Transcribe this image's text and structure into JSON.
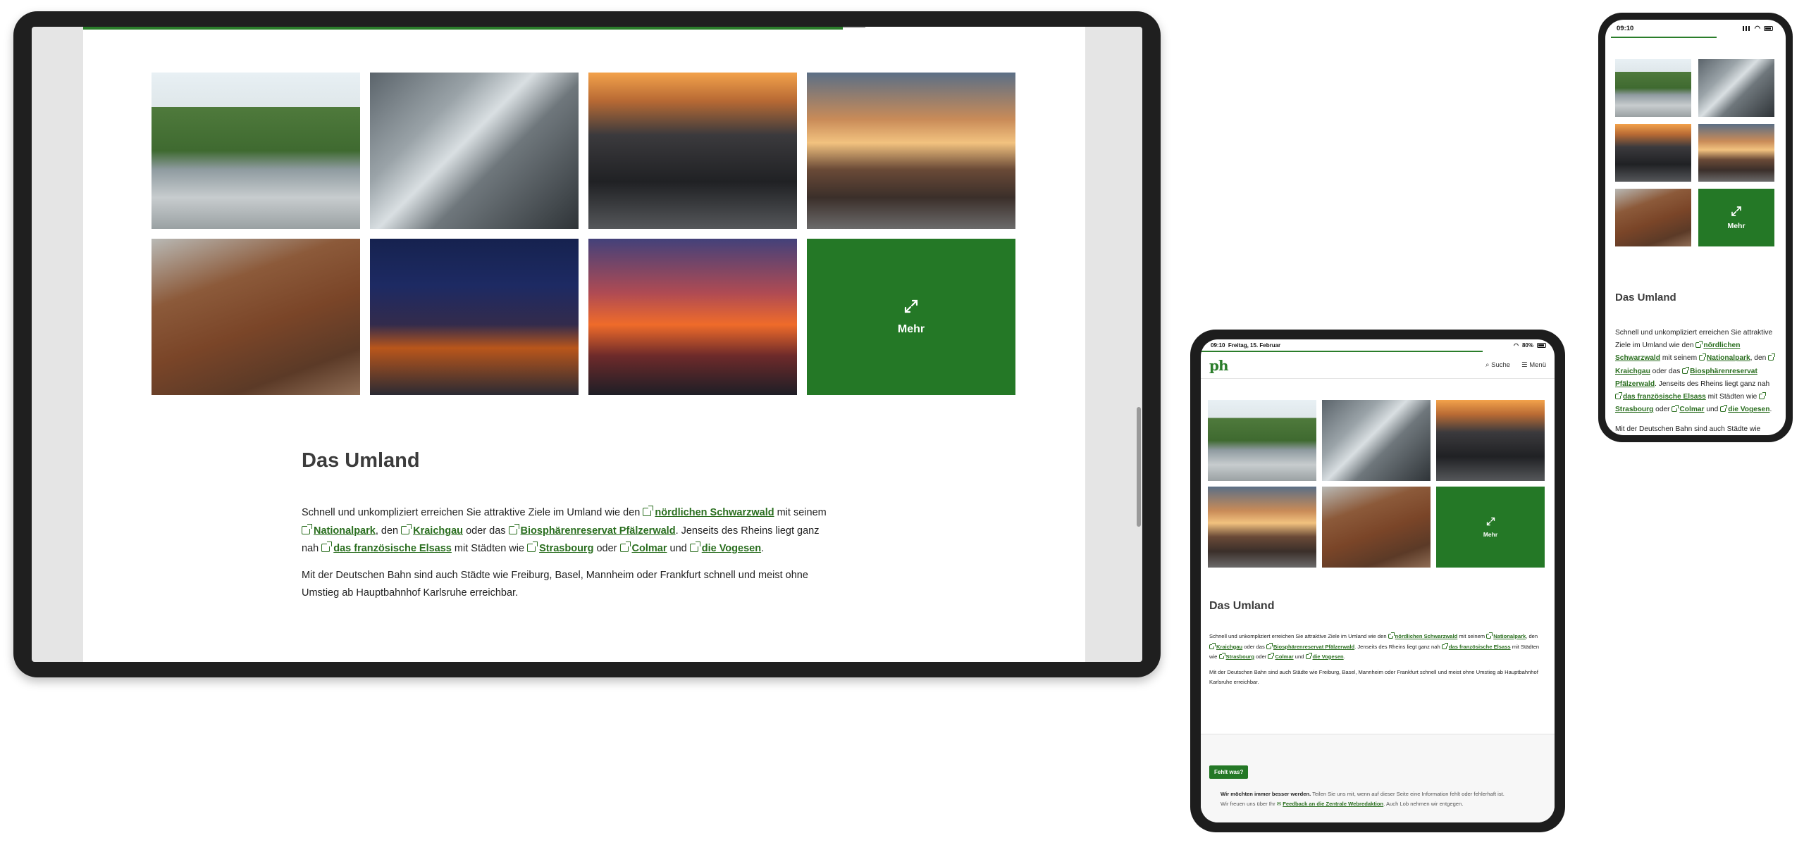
{
  "colors": {
    "brand_green": "#247826",
    "link_green": "#2a6e1f"
  },
  "gallery": {
    "more_label": "Mehr",
    "images": [
      {
        "alt": "fountain-street"
      },
      {
        "alt": "cyclist-pole"
      },
      {
        "alt": "tram-tracks-sunset"
      },
      {
        "alt": "castle-sunset"
      },
      {
        "alt": "rusty-metal"
      },
      {
        "alt": "city-night"
      },
      {
        "alt": "ferris-wheel-sunset"
      }
    ]
  },
  "section": {
    "title": "Das Umland",
    "p1": {
      "t1": "Schnell und unkompliziert erreichen Sie attraktive Ziele im Umland wie den ",
      "l1": "nördlichen Schwarzwald",
      "t2": " mit seinem ",
      "l2": "Nationalpark",
      "t3": ", den ",
      "l3": "Kraichgau",
      "t4": " oder das ",
      "l4": "Biosphärenreservat Pfälzerwald",
      "t5": ". Jenseits des Rheins liegt ganz nah ",
      "l5": "das französische Elsass",
      "t6": " mit Städten wie ",
      "l6": "Strasbourg",
      "t7": " oder ",
      "l7": "Colmar",
      "t8": " und ",
      "l8": "die Vogesen",
      "t9": "."
    },
    "p2": "Mit der Deutschen Bahn sind auch Städte wie Freiburg, Basel, Mannheim oder Frankfurt schnell und meist ohne Umstieg ab Hauptbahnhof Karlsruhe erreichbar."
  },
  "ipad": {
    "status": {
      "time": "09:10",
      "date": "Freitag, 15. Februar",
      "battery": "80%"
    },
    "logo": "ph",
    "search": "Suche",
    "menu": "Menü",
    "footer": {
      "button": "Fehlt was?",
      "bold": "Wir möchten immer besser werden.",
      "text1": " Teilen Sie uns mit, wenn auf dieser Seite eine Information fehlt oder fehlerhaft ist.",
      "text2": "Wir freuen uns über Ihr ",
      "link": "Feedback an die Zentrale Webredaktion",
      "text3": ". Auch Lob nehmen wir entgegen."
    }
  },
  "phone": {
    "status": {
      "time": "09:10"
    }
  }
}
